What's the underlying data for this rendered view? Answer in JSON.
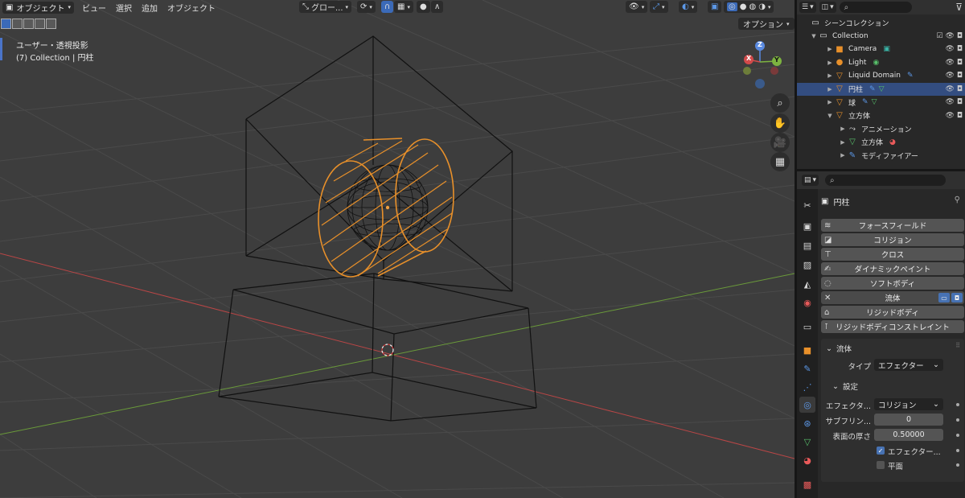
{
  "header": {
    "mode": "オブジェクト",
    "menus": [
      "ビュー",
      "選択",
      "追加",
      "オブジェクト"
    ],
    "transform_orientation": "グロー...",
    "options": "オプション"
  },
  "viewport": {
    "view_name": "ユーザー・透視投影",
    "collection_info": "(7) Collection | 円柱",
    "gizmo": {
      "z": "Z",
      "x": "X",
      "y": "Y"
    }
  },
  "outliner": {
    "scene_collection": "シーンコレクション",
    "rows": [
      {
        "label": "Collection",
        "icon": "collection-icon"
      },
      {
        "label": "Camera",
        "icon": "camera-icon"
      },
      {
        "label": "Light",
        "icon": "light-icon"
      },
      {
        "label": "Liquid Domain",
        "icon": "mesh-icon"
      },
      {
        "label": "円柱",
        "icon": "mesh-icon",
        "selected": true
      },
      {
        "label": "球",
        "icon": "mesh-icon"
      },
      {
        "label": "立方体",
        "icon": "mesh-icon"
      },
      {
        "label": "アニメーション",
        "icon": "animation-icon"
      },
      {
        "label": "立方体",
        "icon": "mesh-data-icon"
      },
      {
        "label": "モディファイアー",
        "icon": "wrench-icon"
      }
    ]
  },
  "properties": {
    "object_name": "円柱",
    "physics_buttons": [
      "フォースフィールド",
      "コリジョン",
      "クロス",
      "ダイナミックペイント",
      "ソフトボディ",
      "流体",
      "リジッドボディ",
      "リジッドボディコンストレイント"
    ],
    "fluid_panel": {
      "title": "流体",
      "type_label": "タイプ",
      "type_value": "エフェクター",
      "settings_title": "設定",
      "effector_label": "エフェクタ...",
      "effector_value": "コリジョン",
      "subframes_label": "サブフリン...",
      "subframes_value": "0",
      "surface_label": "表面の厚さ",
      "surface_value": "0.50000",
      "use_effector_label": "エフェクター...",
      "use_effector_checked": true,
      "plane_label": "平面",
      "plane_checked": false
    }
  },
  "colors": {
    "viewport_bg": "#3d3d3d",
    "selection_orange": "#e8902a",
    "accent_blue": "#4772b3",
    "x_axis": "#c24b4b",
    "y_axis": "#6a9a3a"
  }
}
